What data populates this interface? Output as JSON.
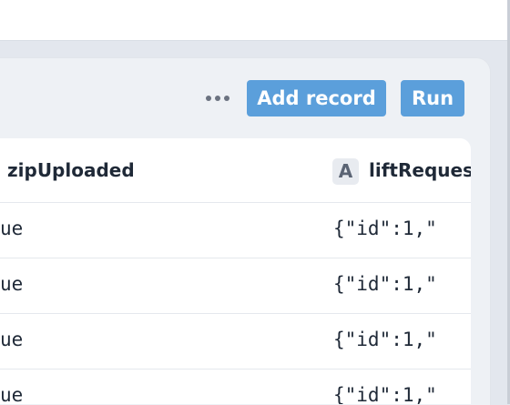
{
  "toolbar": {
    "more_label": "More options",
    "add_record_label": "Add record",
    "run_label": "Run"
  },
  "table": {
    "columns": [
      {
        "name": "zipUploaded",
        "type_icon": "A"
      },
      {
        "name": "liftRequest",
        "type_icon": "A"
      }
    ],
    "rows": [
      {
        "zipUploaded": "ue",
        "liftRequest": "{\"id\":1,\""
      },
      {
        "zipUploaded": "ue",
        "liftRequest": "{\"id\":1,\""
      },
      {
        "zipUploaded": "ue",
        "liftRequest": "{\"id\":1,\""
      },
      {
        "zipUploaded": "ue",
        "liftRequest": "{\"id\":1,\""
      }
    ]
  },
  "colors": {
    "accent": "#5b9fdb",
    "background": "#e3e7ee",
    "panel": "#eef1f5",
    "text": "#1f2937"
  }
}
